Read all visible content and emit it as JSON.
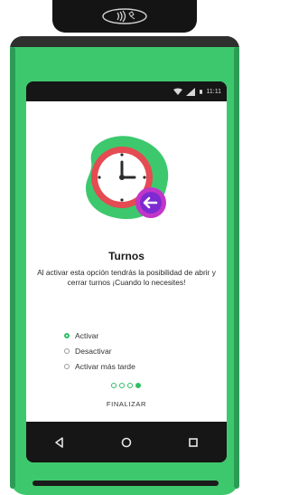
{
  "device": {
    "nfc_icon": "contactless-icon",
    "status_bar": {
      "wifi_icon": "wifi-icon",
      "signal_icon": "signal-icon",
      "battery_icon": "battery-icon",
      "time": "11:11"
    },
    "navigation": {
      "back_icon": "back-triangle-icon",
      "home_icon": "home-circle-icon",
      "recent_icon": "recent-square-icon"
    }
  },
  "onboarding": {
    "illustration_icon": "clock-arrow-icon",
    "title": "Turnos",
    "description": "Al activar esta opción tendrás la posibilidad de abrir y cerrar turnos ¡Cuando lo necesites!",
    "options": [
      {
        "label": "Activar",
        "selected": true
      },
      {
        "label": "Desactivar",
        "selected": false
      },
      {
        "label": "Activar más tarde",
        "selected": false
      }
    ],
    "pager": {
      "total": 4,
      "current": 4
    },
    "finish_label": "FINALIZAR"
  },
  "colors": {
    "accent": "#2fbf63",
    "device_green": "#3ec86d",
    "clock_red": "#e44b52",
    "badge_purple": "#c235c9"
  }
}
